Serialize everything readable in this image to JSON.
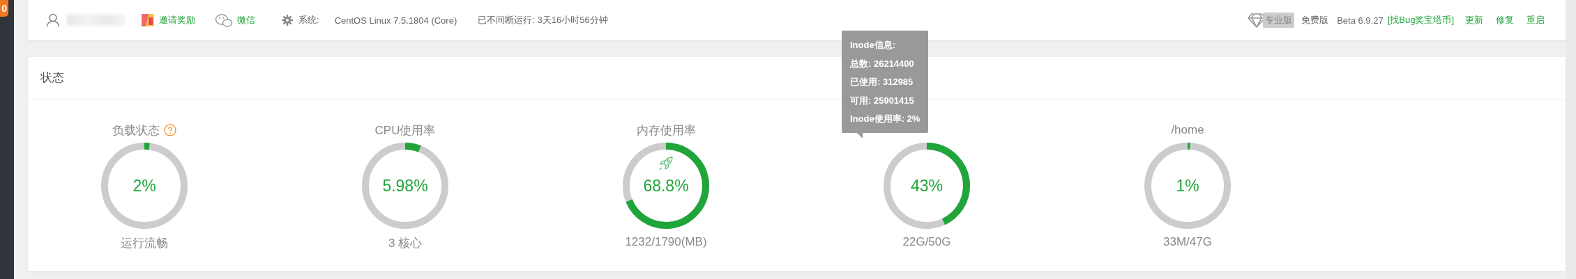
{
  "sidebar": {
    "badge": "0"
  },
  "header": {
    "links": [
      {
        "label": "邀请奖励"
      },
      {
        "label": "微信"
      }
    ],
    "system": {
      "label": "系统:",
      "value": "CentOS Linux 7.5.1804 (Core)"
    },
    "uptime": "已不间断运行: 3天16小时56分钟",
    "pro_badge": "专业版",
    "edition": "免费版",
    "version": "Beta 6.9.27",
    "bug_link": "[找Bug奖宝塔币]",
    "actions": [
      "更新",
      "修复",
      "重启"
    ]
  },
  "status": {
    "title": "状态",
    "gauges": [
      {
        "title": "负载状态",
        "help": true,
        "level": 0.02,
        "value": "2%",
        "rocket": false,
        "detail": "运行流畅"
      },
      {
        "title": "CPU使用率",
        "help": false,
        "level": 0.0598,
        "value": "5.98%",
        "rocket": false,
        "detail": "3 核心"
      },
      {
        "title": "内存使用率",
        "help": false,
        "level": 0.688,
        "value": "68.8%",
        "rocket": true,
        "detail": "1232/1790(MB)"
      },
      {
        "help": false,
        "level": 0.43,
        "value": "43%",
        "rocket": false,
        "detail": "22G/50G",
        "tooltip": [
          "Inode信息:",
          "总数: 26214400",
          "已使用: 312985",
          "可用: 25901415",
          "Inode使用率: 2%"
        ]
      },
      {
        "title": "/home",
        "help": false,
        "level": 0.01,
        "value": "1%",
        "rocket": false,
        "detail": "33M/47G"
      }
    ]
  }
}
